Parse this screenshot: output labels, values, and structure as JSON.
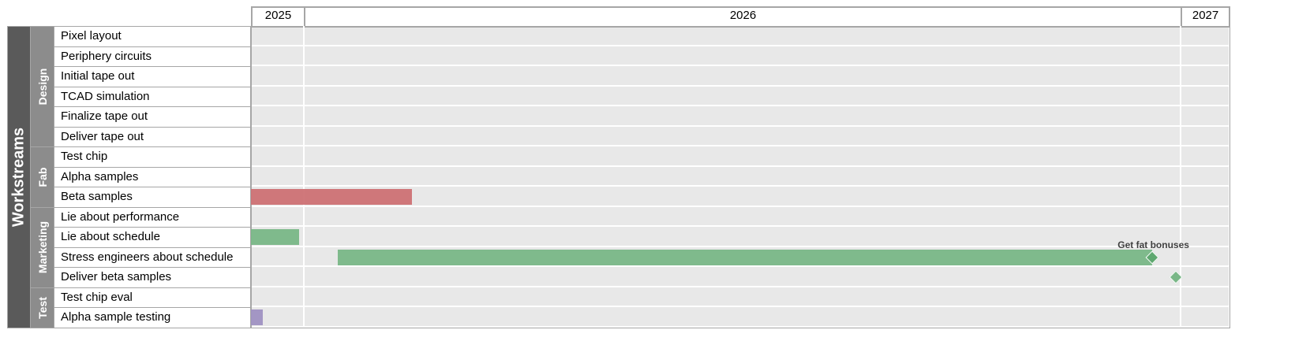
{
  "chart_data": {
    "type": "gantt",
    "axis_label": "Workstreams",
    "x_range": [
      "2025-12-10",
      "2027-01-21"
    ],
    "year_ticks": [
      {
        "label": "2025",
        "start": "2025-12-10",
        "end": "2026-01-01"
      },
      {
        "label": "2026",
        "start": "2026-01-01",
        "end": "2027-01-01"
      },
      {
        "label": "2027",
        "start": "2027-01-01",
        "end": "2027-01-21"
      }
    ],
    "groups": [
      {
        "name": "Design",
        "tasks": [
          "Pixel layout",
          "Periphery circuits",
          "Initial tape out",
          "TCAD simulation",
          "Finalize tape out",
          "Deliver tape out"
        ]
      },
      {
        "name": "Fab",
        "tasks": [
          "Test chip",
          "Alpha samples",
          "Beta samples"
        ]
      },
      {
        "name": "Marketing",
        "tasks": [
          "Lie about performance",
          "Lie about schedule",
          "Stress engineers about schedule",
          "Deliver beta samples"
        ]
      },
      {
        "name": "Test",
        "tasks": [
          "Test chip eval",
          "Alpha sample testing"
        ]
      }
    ],
    "bars": [
      {
        "task": "Beta samples",
        "start": "2025-12-10",
        "end": "2026-02-15",
        "color": "#cd7174"
      },
      {
        "task": "Lie about schedule",
        "start": "2025-12-10",
        "end": "2025-12-30",
        "color": "#79b787"
      },
      {
        "task": "Stress engineers about schedule",
        "start": "2026-01-15",
        "end": "2026-12-20",
        "color": "#79b787"
      },
      {
        "task": "Alpha sample testing",
        "start": "2025-12-10",
        "end": "2025-12-15",
        "color": "#9f91c2"
      }
    ],
    "milestones": [
      {
        "task": "Stress engineers about schedule",
        "date": "2026-12-20",
        "color": "#5fa870",
        "label": "Get fat bonuses"
      },
      {
        "task": "Deliver beta samples",
        "date": "2026-12-30",
        "color": "#79b787"
      }
    ]
  }
}
